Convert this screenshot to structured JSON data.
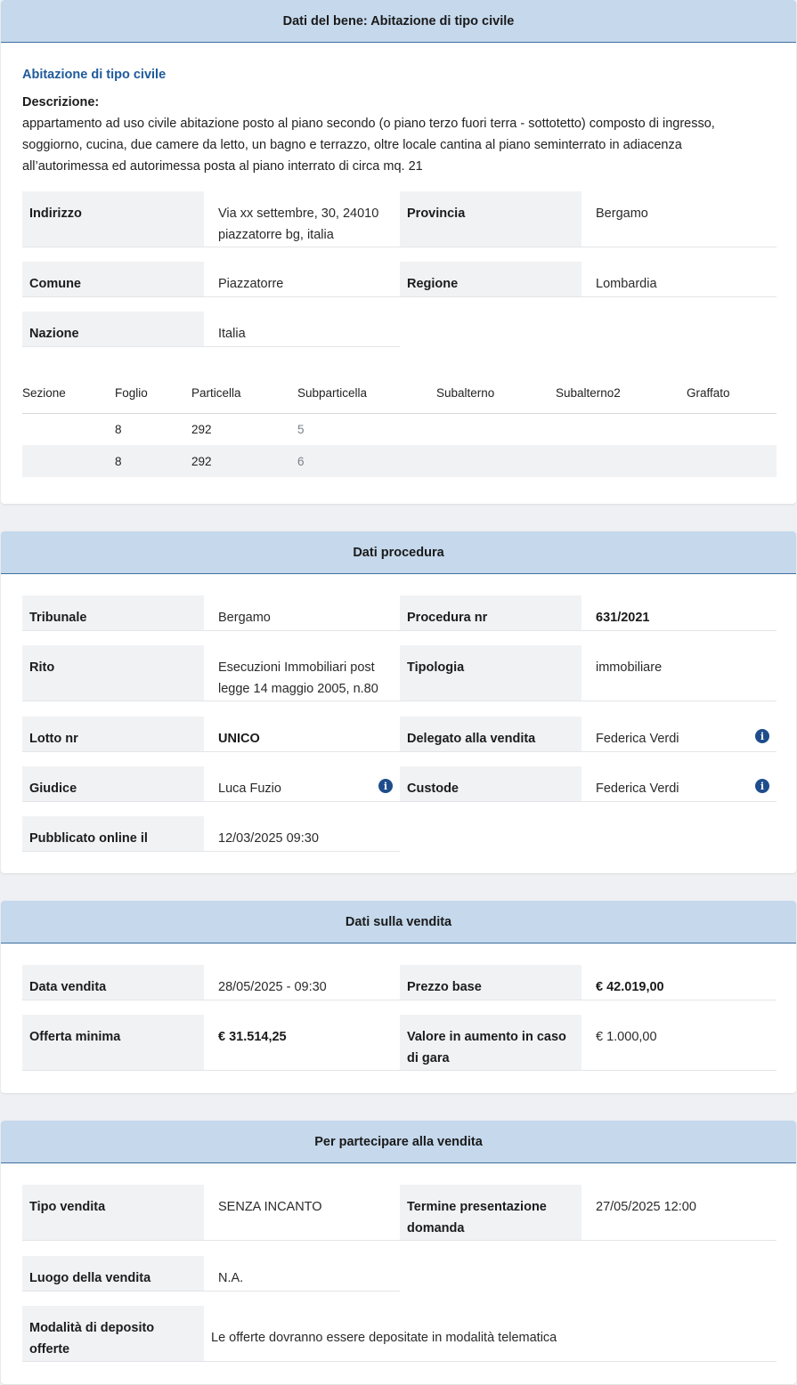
{
  "bene": {
    "header": "Dati del bene: Abitazione di tipo civile",
    "subtitle": "Abitazione di tipo civile",
    "desc_label": "Descrizione:",
    "desc_text": "appartamento ad uso civile abitazione posto al piano secondo (o piano terzo fuori terra - sottotetto) composto di ingresso, soggiorno, cucina, due camere da letto, un bagno e terrazzo, oltre locale cantina al piano seminterrato in adiacenza all’autorimessa ed autorimessa posta al piano interrato di circa mq. 21",
    "indirizzo_label": "Indirizzo",
    "indirizzo_value": "Via xx settembre, 30, 24010 piazzatorre bg, italia",
    "provincia_label": "Provincia",
    "provincia_value": "Bergamo",
    "comune_label": "Comune",
    "comune_value": "Piazzatorre",
    "regione_label": "Regione",
    "regione_value": "Lombardia",
    "nazione_label": "Nazione",
    "nazione_value": "Italia",
    "table": {
      "headers": [
        "Sezione",
        "Foglio",
        "Particella",
        "Subparticella",
        "Subalterno",
        "Subalterno2",
        "Graffato"
      ],
      "rows": [
        [
          "",
          "8",
          "292",
          "5",
          "",
          "",
          ""
        ],
        [
          "",
          "8",
          "292",
          "6",
          "",
          "",
          ""
        ]
      ]
    }
  },
  "procedura": {
    "header": "Dati procedura",
    "tribunale_label": "Tribunale",
    "tribunale_value": "Bergamo",
    "procedura_label": "Procedura nr",
    "procedura_value": "631/2021",
    "rito_label": "Rito",
    "rito_value": "Esecuzioni Immobiliari post legge 14 maggio 2005, n.80",
    "tipologia_label": "Tipologia",
    "tipologia_value": "immobiliare",
    "lotto_label": "Lotto nr",
    "lotto_value": "UNICO",
    "delegato_label": "Delegato alla vendita",
    "delegato_value": "Federica Verdi",
    "giudice_label": "Giudice",
    "giudice_value": "Luca Fuzio",
    "custode_label": "Custode",
    "custode_value": "Federica Verdi",
    "pubblicato_label": "Pubblicato online il",
    "pubblicato_value": "12/03/2025 09:30",
    "info_icon": "i"
  },
  "vendita": {
    "header": "Dati sulla vendita",
    "data_label": "Data vendita",
    "data_value": "28/05/2025 - 09:30",
    "prezzo_label": "Prezzo base",
    "prezzo_value": "€ 42.019,00",
    "offerta_label": "Offerta minima",
    "offerta_value": "€ 31.514,25",
    "aumento_label": "Valore in aumento in caso di gara",
    "aumento_value": "€ 1.000,00"
  },
  "partecipare": {
    "header": "Per partecipare alla vendita",
    "tipo_label": "Tipo vendita",
    "tipo_value": "SENZA INCANTO",
    "termine_label": "Termine presentazione domanda",
    "termine_value": "27/05/2025 12:00",
    "luogo_label": "Luogo della vendita",
    "luogo_value": "N.A.",
    "modalita_label": "Modalità di deposito offerte",
    "modalita_value": "Le offerte dovranno essere depositate in modalità telematica"
  },
  "colors": {
    "header_bg": "#c5d8ec",
    "header_border": "#3f6f9f",
    "label_bg": "#f1f2f4",
    "accent": "#1f5a9a",
    "info_icon": "#1f4d8c"
  }
}
